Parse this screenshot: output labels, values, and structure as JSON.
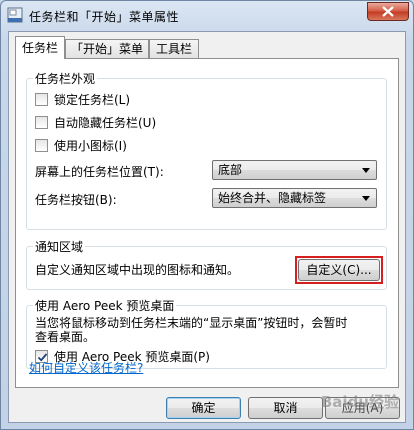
{
  "window": {
    "title": "任务栏和「开始」菜单属性"
  },
  "tabs": [
    {
      "label": "任务栏"
    },
    {
      "label": "「开始」菜单"
    },
    {
      "label": "工具栏"
    }
  ],
  "appearance": {
    "title": "任务栏外观",
    "lock_label": "锁定任务栏(L)",
    "lock_checked": false,
    "autohide_label": "自动隐藏任务栏(U)",
    "autohide_checked": false,
    "small_icons_label": "使用小图标(I)",
    "small_icons_checked": false,
    "location_label": "屏幕上的任务栏位置(T):",
    "location_value": "底部",
    "buttons_label": "任务栏按钮(B):",
    "buttons_value": "始终合并、隐藏标签"
  },
  "notification": {
    "title": "通知区域",
    "description": "自定义通知区域中出现的图标和通知。",
    "customize_button": "自定义(C)..."
  },
  "aero_peek": {
    "title": "使用 Aero Peek 预览桌面",
    "description_line1": "当您将鼠标移动到任务栏末端的“显示桌面”按钮时，会暂时",
    "description_line2": "查看桌面。",
    "checkbox_label": "使用 Aero Peek 预览桌面(P)",
    "checkbox_checked": true
  },
  "help_link": "如何自定义该任务栏?",
  "footer": {
    "ok": "确定",
    "cancel": "取消",
    "apply": "应用(A)"
  },
  "watermark": "Baidu经验"
}
